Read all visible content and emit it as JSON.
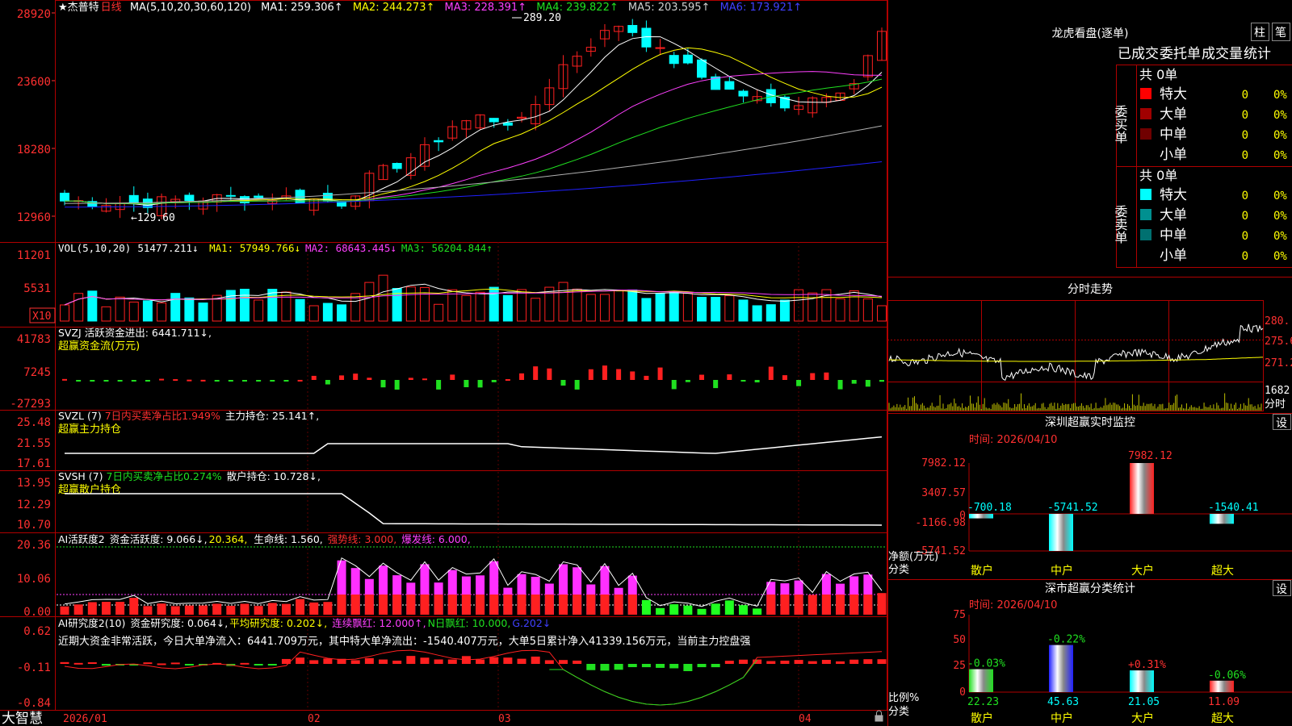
{
  "app": {
    "brand": "大智慧",
    "stock_name": "★杰普特",
    "period": "日线"
  },
  "colors": {
    "up": "#ff2020",
    "down": "#00ffff",
    "white": "#ffffff",
    "ma2": "#ffff00",
    "ma3": "#ff40ff",
    "ma4": "#20e020",
    "ma5": "#b0b0b0",
    "ma6": "#2020ff",
    "grid": "#b00000"
  },
  "x_axis": {
    "label_2026_01": "2026/01",
    "label_02": "02",
    "label_03": "03",
    "label_04": "04"
  },
  "kline": {
    "ma_header": "MA(5,10,20,30,60,120)",
    "ma1": "MA1: 259.306↑",
    "ma2": "MA2: 244.273↑",
    "ma3": "MA3: 228.391↑",
    "ma4": "MA4: 239.822↑",
    "ma5": "MA5: 203.595↑",
    "ma6": "MA6: 173.921↑",
    "y_ticks": [
      "28920",
      "23600",
      "18280",
      "12960"
    ],
    "high_label": "289.20",
    "low_label": "129.60"
  },
  "vol": {
    "title": "VOL(5,10,20)",
    "value": "51477.211↓",
    "ma1": "MA1: 57949.766↓",
    "ma2": "MA2: 68643.445↓",
    "ma3": "MA3: 56204.844↑",
    "y_ticks": [
      "11201",
      "5531"
    ],
    "unit": "X10"
  },
  "svzj": {
    "title": "SVZJ  活跃资金进出: 6441.711↓,",
    "subtitle": "超赢资金流(万元)",
    "y_ticks": [
      "41783",
      "7245",
      "-27293"
    ]
  },
  "svzl": {
    "title": "SVZL  (7)",
    "ratio": "7日内买卖净占比1.949%",
    "hold": "主力持仓: 25.141↑,",
    "subtitle": "超赢主力持仓",
    "y_ticks": [
      "25.48",
      "21.55",
      "17.61"
    ]
  },
  "svsh": {
    "title": "SVSH  (7)",
    "ratio": "7日内买卖净占比0.274%",
    "hold": "散户持仓: 10.728↓,",
    "subtitle": "超赢散户持仓",
    "y_ticks": [
      "13.95",
      "12.29",
      "10.70"
    ]
  },
  "ai_active": {
    "title": "AI活跃度2",
    "active": "资金活跃度: 9.066↓,",
    "v2": "20.364,",
    "life": "生命线: 1.560,",
    "strong": "强势线: 3.000,",
    "burst": "爆发线: 6.000,",
    "y_ticks": [
      "20.36",
      "10.06",
      "0.00"
    ]
  },
  "ai_research": {
    "title": "AI研究度2(10)",
    "research": "资金研究度: 0.064↓,",
    "avg": "平均研究度: 0.202↓,",
    "red": "连续飘红: 12.000↑,",
    "nred": "N日飘红: 10.000,",
    "g": "G.202↓",
    "comment": "近期大资金非常活跃，今日大单净流入：6441.709万元，其中特大单净流出：-1540.407万元，大单5日累计净入41339.156万元，当前主力控盘强",
    "y_ticks": [
      "0.62",
      "-0.11",
      "-0.84"
    ]
  },
  "right": {
    "lhb_title": "龙虎看盘(逐单)",
    "btn_bar": "柱",
    "btn_pen": "笔",
    "tabs": [
      "已成交",
      "委托单",
      "成交量",
      "统计"
    ],
    "buy_label": "委买单",
    "sell_label": "委卖单",
    "buy_total": "共 0单",
    "sell_total": "共 0单",
    "buy_rows": [
      {
        "name": "特大",
        "n": "0",
        "p": "0%",
        "c": "#ff0000"
      },
      {
        "name": "大单",
        "n": "0",
        "p": "0%",
        "c": "#a00000"
      },
      {
        "name": "中单",
        "n": "0",
        "p": "0%",
        "c": "#700000"
      },
      {
        "name": "小单",
        "n": "0",
        "p": "0%",
        "c": ""
      }
    ],
    "sell_rows": [
      {
        "name": "特大",
        "n": "0",
        "p": "0%",
        "c": "#00ffff"
      },
      {
        "name": "大单",
        "n": "0",
        "p": "0%",
        "c": "#009090"
      },
      {
        "name": "中单",
        "n": "0",
        "p": "0%",
        "c": "#007070"
      },
      {
        "name": "小单",
        "n": "0",
        "p": "0%",
        "c": ""
      }
    ],
    "fs_title": "分时走势",
    "fs_y": [
      "280.",
      "275.6",
      "271.2"
    ],
    "fs_vol": "1682",
    "fs_vol_label": "分时",
    "sz_title": "深圳超赢实时监控",
    "sz_set": "设",
    "sz_time": "时间: 2026/04/10",
    "sz_y": [
      "7982.12",
      "3407.57",
      "0",
      "-1166.98",
      "-5741.52"
    ],
    "sz_net_label": "净额(万元)",
    "sz_cat_label": "分类",
    "sc_title": "深市超赢分类统计",
    "sc_set": "设",
    "sc_time": "时间: 2026/04/10",
    "sc_y": [
      "75",
      "50",
      "25",
      "0"
    ],
    "sc_ratio_label": "比例%",
    "sc_cat_label": "分类"
  },
  "chart_data": [
    {
      "type": "bar",
      "title": "深圳超赢实时监控",
      "ylabel": "净额(万元)",
      "categories": [
        "散户",
        "中户",
        "大户",
        "超大"
      ],
      "values": [
        -700.18,
        -5741.52,
        7982.12,
        -1540.41
      ],
      "ylim": [
        -5741.52,
        7982.12
      ]
    },
    {
      "type": "bar",
      "title": "深市超赢分类统计",
      "ylabel": "比例%",
      "categories": [
        "散户",
        "中户",
        "大户",
        "超大"
      ],
      "values": [
        22.23,
        45.63,
        21.05,
        11.09
      ],
      "changes": [
        "-0.03%",
        "-0.22%",
        "+0.31%",
        "-0.06%"
      ],
      "ylim": [
        0,
        75
      ]
    }
  ]
}
